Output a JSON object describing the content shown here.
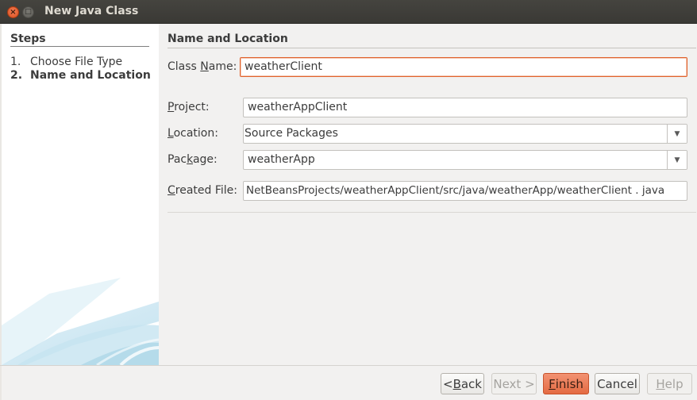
{
  "window": {
    "title": "New Java Class",
    "close_glyph": "×",
    "maximize_glyph": "□"
  },
  "steps": {
    "title": "Steps",
    "items": [
      {
        "num": "1.",
        "label": "Choose File Type"
      },
      {
        "num": "2.",
        "label": "Name and Location"
      }
    ]
  },
  "panel": {
    "title": "Name and Location",
    "class_name": {
      "label_pre": "Class ",
      "label_mn": "N",
      "label_post": "ame:",
      "value": "weatherClient"
    },
    "project": {
      "label_pre": "",
      "label_mn": "P",
      "label_post": "roject:",
      "value": "weatherAppClient"
    },
    "location": {
      "label_pre": "",
      "label_mn": "L",
      "label_post": "ocation:",
      "value": "Source Packages"
    },
    "package": {
      "label_pre": "Pac",
      "label_mn": "k",
      "label_post": "age:",
      "value": "weatherApp"
    },
    "created_file": {
      "label_pre": "",
      "label_mn": "C",
      "label_post": "reated File:",
      "value": "NetBeansProjects/weatherAppClient/src/java/weatherApp/weatherClient . java"
    }
  },
  "buttons": {
    "back": {
      "pre": "< ",
      "mn": "B",
      "post": "ack"
    },
    "next": {
      "pre": "Next >",
      "mn": "",
      "post": ""
    },
    "finish": {
      "pre": "",
      "mn": "F",
      "post": "inish"
    },
    "cancel": {
      "pre": "Cancel",
      "mn": "",
      "post": ""
    },
    "help": {
      "pre": "",
      "mn": "H",
      "post": "elp"
    }
  },
  "colors": {
    "accent": "#e46b43",
    "focus_border": "#e0622c",
    "titlebar": "#3c3b37"
  },
  "icons": {
    "close": "close-icon",
    "maximize": "maximize-icon",
    "dropdown": "chevron-down-icon"
  }
}
